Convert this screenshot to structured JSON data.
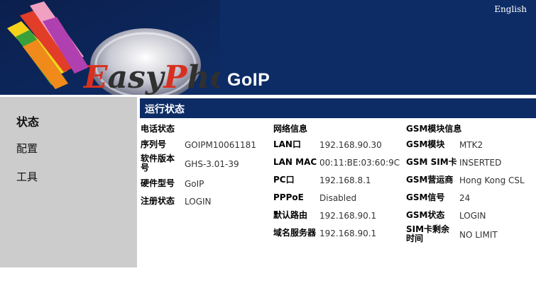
{
  "header": {
    "logo_text": "EasyPhone",
    "product_name": "GoIP",
    "language_link": "English"
  },
  "sidebar": {
    "items": [
      {
        "label": "状态",
        "active": true
      },
      {
        "label": "配置",
        "active": false
      },
      {
        "label": "工具",
        "active": false
      }
    ]
  },
  "section": {
    "title": "运行状态"
  },
  "phone_status": {
    "heading": "电话状态",
    "rows": [
      {
        "label": "序列号",
        "value": "GOIPM10061181"
      },
      {
        "label": "软件版本号",
        "value": "GHS-3.01-39"
      },
      {
        "label": "硬件型号",
        "value": "GoIP"
      },
      {
        "label": "注册状态",
        "value": "LOGIN"
      }
    ]
  },
  "network_info": {
    "heading": "网络信息",
    "rows": [
      {
        "label": "LAN口",
        "value": "192.168.90.30"
      },
      {
        "label": "LAN MAC",
        "value": "00:11:BE:03:60:9C"
      },
      {
        "label": "PC口",
        "value": "192.168.8.1"
      },
      {
        "label": "PPPoE",
        "value": "Disabled"
      },
      {
        "label": "默认路由",
        "value": "192.168.90.1"
      },
      {
        "label": "域名服务器",
        "value": "192.168.90.1"
      }
    ]
  },
  "gsm_info": {
    "heading": "GSM模块信息",
    "rows": [
      {
        "label": "GSM模块",
        "value": "MTK2"
      },
      {
        "label": "GSM SIM卡",
        "value": "INSERTED"
      },
      {
        "label": "GSM营运商",
        "value": "Hong Kong CSL"
      },
      {
        "label": "GSM信号",
        "value": "24"
      },
      {
        "label": "GSM状态",
        "value": "LOGIN"
      },
      {
        "label": "SIM卡剩余时间",
        "value": "NO LIMIT"
      }
    ]
  },
  "colors": {
    "header_bg": "#0d2c66",
    "sidebar_bg": "#cccccc"
  }
}
